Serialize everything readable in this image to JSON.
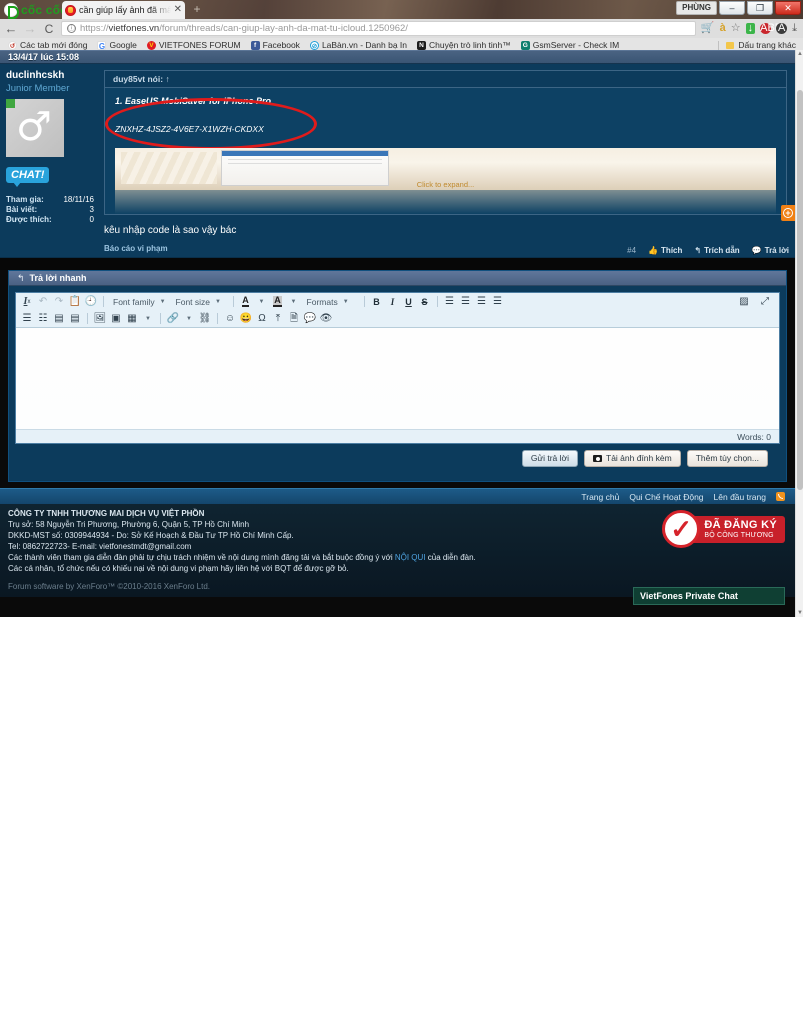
{
  "browser": {
    "brand": "cốc cốc",
    "tab": {
      "title": "cần giúp lấy ảnh đã mất tu",
      "close": "✕"
    },
    "new_tab": "+",
    "window": {
      "user": "PHÙNG",
      "minimize": "–",
      "maximize": "❐",
      "close": "✕"
    },
    "nav": {
      "back": "←",
      "forward": "→",
      "reload": "C"
    },
    "url": {
      "scheme": "https://",
      "host": "vietfones.vn",
      "path": "/forum/threads/can-giup-lay-anh-da-mat-tu-icloud.1250962/",
      "info_icon": "ⓘ"
    },
    "omni_icons": [
      "cart-icon",
      "accent-a-icon",
      "star-icon",
      "download-icon",
      "adblock-icon",
      "account-icon",
      "menu-icon"
    ],
    "bookmarks": [
      {
        "label": "Các tab mới đóng",
        "icon": "recent-tabs-icon",
        "glyph": "↺"
      },
      {
        "label": "Google",
        "icon": "google-icon",
        "glyph": "G"
      },
      {
        "label": "VIETFONES FORUM",
        "icon": "vietfones-icon",
        "glyph": "V"
      },
      {
        "label": "Facebook",
        "icon": "facebook-icon",
        "glyph": "f"
      },
      {
        "label": "LaBàn.vn - Danh bạ In",
        "icon": "laban-icon",
        "glyph": "⊘"
      },
      {
        "label": "Chuyện trò linh tinh™",
        "icon": "chat-icon",
        "glyph": "N"
      },
      {
        "label": "GsmServer - Check IM",
        "icon": "gsmserver-icon",
        "glyph": "G"
      }
    ],
    "bookmarks_other": "Dấu trang khác"
  },
  "forum": {
    "post_date": "13/4/17 lúc 15:08",
    "author": {
      "username": "duclinhcskh",
      "title": "Junior Member",
      "avatar_glyph": "♂",
      "chat_label": "CHAT!",
      "stats": [
        {
          "label": "Tham gia:",
          "value": "18/11/16"
        },
        {
          "label": "Bài viết:",
          "value": "3"
        },
        {
          "label": "Được thích:",
          "value": "0"
        }
      ]
    },
    "quote": {
      "header": "duy85vt nói:",
      "header_arrow": "↑",
      "title": "1. EaseUS MobiSaver for iPhone Pro",
      "serial": "ZNXHZ-4JSZ2-4V6E7-X1WZH-CKDXX",
      "expand_label": "Click to expand..."
    },
    "message": "kêu nhập code là sao vậy bác",
    "report": "Báo cáo vi phạm",
    "actions": {
      "post_number": "#4",
      "like": "Thích",
      "quote": "Trích dẫn",
      "reply": "Trả lời"
    },
    "float_button": "+"
  },
  "quick_reply": {
    "header": "Trả lời nhanh",
    "header_icon": "reply-arrow-icon",
    "toolbar_row1": [
      {
        "name": "remove-format-icon",
        "glyph": "Ix"
      },
      {
        "name": "undo-icon",
        "glyph": "↶"
      },
      {
        "name": "redo-icon",
        "glyph": "↷"
      },
      {
        "name": "paste-icon",
        "glyph": "📋"
      },
      {
        "name": "history-icon",
        "glyph": "🕘"
      }
    ],
    "font_family": "Font family",
    "font_size": "Font size",
    "formats": "Formats",
    "text_color_icon": "text-color-icon",
    "highlight_color_icon": "highlight-color-icon",
    "bold": "B",
    "italic": "I",
    "underline": "U",
    "strike": "S",
    "align": [
      "align-left-icon",
      "align-center-icon",
      "align-right-icon",
      "align-justify-icon"
    ],
    "toolbar_row2": [
      {
        "name": "bullet-list-icon",
        "glyph": "☰"
      },
      {
        "name": "numbered-list-icon",
        "glyph": "☷"
      },
      {
        "name": "outdent-icon",
        "glyph": "⬅"
      },
      {
        "name": "indent-icon",
        "glyph": "➡"
      },
      {
        "name": "insert-image-icon",
        "glyph": "🖼"
      },
      {
        "name": "insert-media-icon",
        "glyph": "▣"
      },
      {
        "name": "insert-table-icon",
        "glyph": "▦"
      },
      {
        "name": "insert-link-icon",
        "glyph": "🔗"
      },
      {
        "name": "unlink-icon",
        "glyph": "⛓"
      },
      {
        "name": "smilies-icon",
        "glyph": "☺"
      },
      {
        "name": "emoji-icon",
        "glyph": "😀"
      },
      {
        "name": "special-char-icon",
        "glyph": "Ω"
      },
      {
        "name": "upload-icon",
        "glyph": "⤒"
      },
      {
        "name": "insert-bbcode-icon",
        "glyph": "🗎"
      },
      {
        "name": "draft-icon",
        "glyph": "💬"
      },
      {
        "name": "spoiler-icon",
        "glyph": "👁"
      }
    ],
    "source_code_icon": "source-code-icon",
    "fullscreen_icon": "fullscreen-icon",
    "editor_value": "",
    "word_count": "Words: 0",
    "buttons": {
      "submit": "Gửi trả lời",
      "attach": "Tải ảnh đính kèm",
      "more": "Thêm tùy chọn..."
    }
  },
  "footer_nav": {
    "home": "Trang chủ",
    "rules": "Qui Chế Hoạt Động",
    "top": "Lên đầu trang",
    "rss_icon": "rss-icon"
  },
  "footer": {
    "company": "CÔNG TY TNHH THƯƠNG MAI DỊCH VỤ VIỆT PHỒN",
    "address": "Trụ sở: 58 Nguyễn Tri Phương, Phường 6, Quận 5, TP Hồ Chí Minh",
    "license": "DKKD-MST số: 0309944934 - Do: Sở Kế Hoạch & Đầu Tư TP Hồ Chí Minh Cấp.",
    "contact": "Tel: 0862722723- E-mail: vietfonestmdt@gmail.com",
    "disclaimer_1a": "Các thành viên tham gia diễn đàn phải tự chịu trách nhiệm về nội dung mình đăng tải và bắt buộc đồng ý với ",
    "disclaimer_link": "NỘI QUI",
    "disclaimer_1b": " của diễn đàn.",
    "disclaimer_2": "Các cá nhân, tổ chức nếu có khiếu nại về nội dung vi phạm hãy liên hệ với BQT để được gỡ bỏ.",
    "software": "Forum software by XenForo™ ©2010-2016 XenForo Ltd.",
    "badge_line1": "ĐÃ ĐĂNG KÝ",
    "badge_line2": "BỘ CÔNG THƯƠNG",
    "private_chat": "VietFones Private Chat"
  }
}
